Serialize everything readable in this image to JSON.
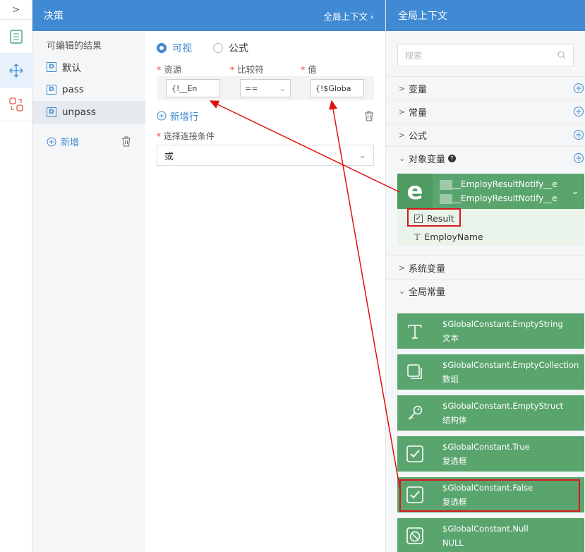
{
  "decision": {
    "title": "决策",
    "global_context_toggle": "全局上下文",
    "results_caption": "可编辑的结果",
    "results": [
      {
        "badge": "D",
        "label": "默认"
      },
      {
        "badge": "D",
        "label": "pass"
      },
      {
        "badge": "D",
        "label": "unpass"
      }
    ],
    "add_label": "新增",
    "mode_visual": "可视",
    "mode_formula": "公式",
    "col_resource": "资源",
    "col_operator": "比较符",
    "col_value": "值",
    "row_resource_value": "{!__En",
    "row_operator_value": "==",
    "row_value_value": "{!$Globa",
    "new_row_label": "新增行",
    "condition_label": "选择连接条件",
    "condition_value": "或"
  },
  "global_context": {
    "title": "全局上下文",
    "search_placeholder": "搜索",
    "sections": {
      "variables": "变量",
      "constants": "常量",
      "formulas": "公式",
      "object_variables": "对象变量",
      "system_variables": "系统变量",
      "global_constants": "全局常量"
    },
    "object_card": {
      "icon_letter": "e",
      "name_line1": "__EmployResultNotify__e",
      "name_line2": "__EmployResultNotify__e",
      "fields": [
        {
          "label": "Result",
          "type": "checkbox"
        },
        {
          "label": "EmployName",
          "type": "text"
        }
      ]
    },
    "constants_list": [
      {
        "name": "$GlobalConstant.EmptyString",
        "type": "文本",
        "icon": "text-T-icon"
      },
      {
        "name": "$GlobalConstant.EmptyCollection",
        "type": "数组",
        "icon": "collection-icon"
      },
      {
        "name": "$GlobalConstant.EmptyStruct",
        "type": "结构体",
        "icon": "key-icon"
      },
      {
        "name": "$GlobalConstant.True",
        "type": "复选框",
        "icon": "checkbox-icon"
      },
      {
        "name": "$GlobalConstant.False",
        "type": "复选框",
        "icon": "checkbox-icon"
      },
      {
        "name": "$GlobalConstant.Null",
        "type": "NULL",
        "icon": "null-icon"
      }
    ]
  },
  "colors": {
    "header_blue": "#3f8ad3",
    "card_green": "#5aa56e",
    "highlight_red": "#d7191c"
  }
}
